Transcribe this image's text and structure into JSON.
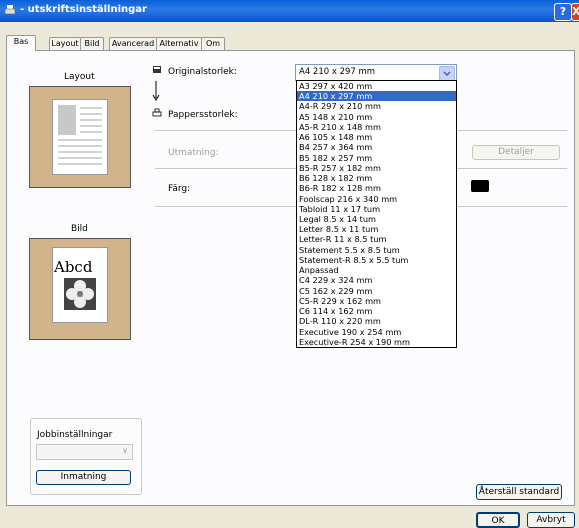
{
  "window": {
    "title": "- utskriftsinställningar",
    "help_button": "?",
    "close_button": "X"
  },
  "tabs": [
    "Bas",
    "Layout",
    "Bild",
    "Avancerad",
    "Alternativ",
    "Om"
  ],
  "left": {
    "layout_label": "Layout",
    "image_label": "Bild",
    "image_text": "Abcd",
    "job_settings": {
      "label": "Jobbinställningar",
      "select_value": "",
      "button_label": "Inmatning"
    }
  },
  "form": {
    "original_size_label": "Originalstorlek:",
    "original_size_value": "A4 210 x 297 mm",
    "paper_size_label": "Pappersstorlek:",
    "output_label": "Utmatning:",
    "details_button": "Detaljer",
    "color_label": "Färg:",
    "options": [
      "A3 297 x 420 mm",
      "A4 210 x 297 mm",
      "A4-R 297 x 210 mm",
      "A5 148 x 210 mm",
      "A5-R 210 x 148 mm",
      "A6 105 x 148 mm",
      "B4 257 x 364 mm",
      "B5 182 x 257 mm",
      "B5-R 257 x 182 mm",
      "B6 128 x 182 mm",
      "B6-R 182 x 128 mm",
      "Foolscap 216 x 340 mm",
      "Tabloid 11 x 17 tum",
      "Legal 8.5 x 14 tum",
      "Letter 8.5 x 11 tum",
      "Letter-R 11 x 8.5 tum",
      "Statement 5.5 x 8.5 tum",
      "Statement-R 8.5 x 5.5 tum",
      "Anpassad",
      "C4 229 x 324 mm",
      "C5 162 x 229 mm",
      "C5-R 229 x 162 mm",
      "C6 114 x 162 mm",
      "DL-R 110 x 220 mm",
      "Executive 190 x 254 mm",
      "Executive-R 254 x 190 mm"
    ],
    "selected_option": "A4 210 x 297 mm"
  },
  "footer": {
    "restore_button": "Återställ standard",
    "ok_button": "OK",
    "cancel_button": "Avbryt"
  }
}
